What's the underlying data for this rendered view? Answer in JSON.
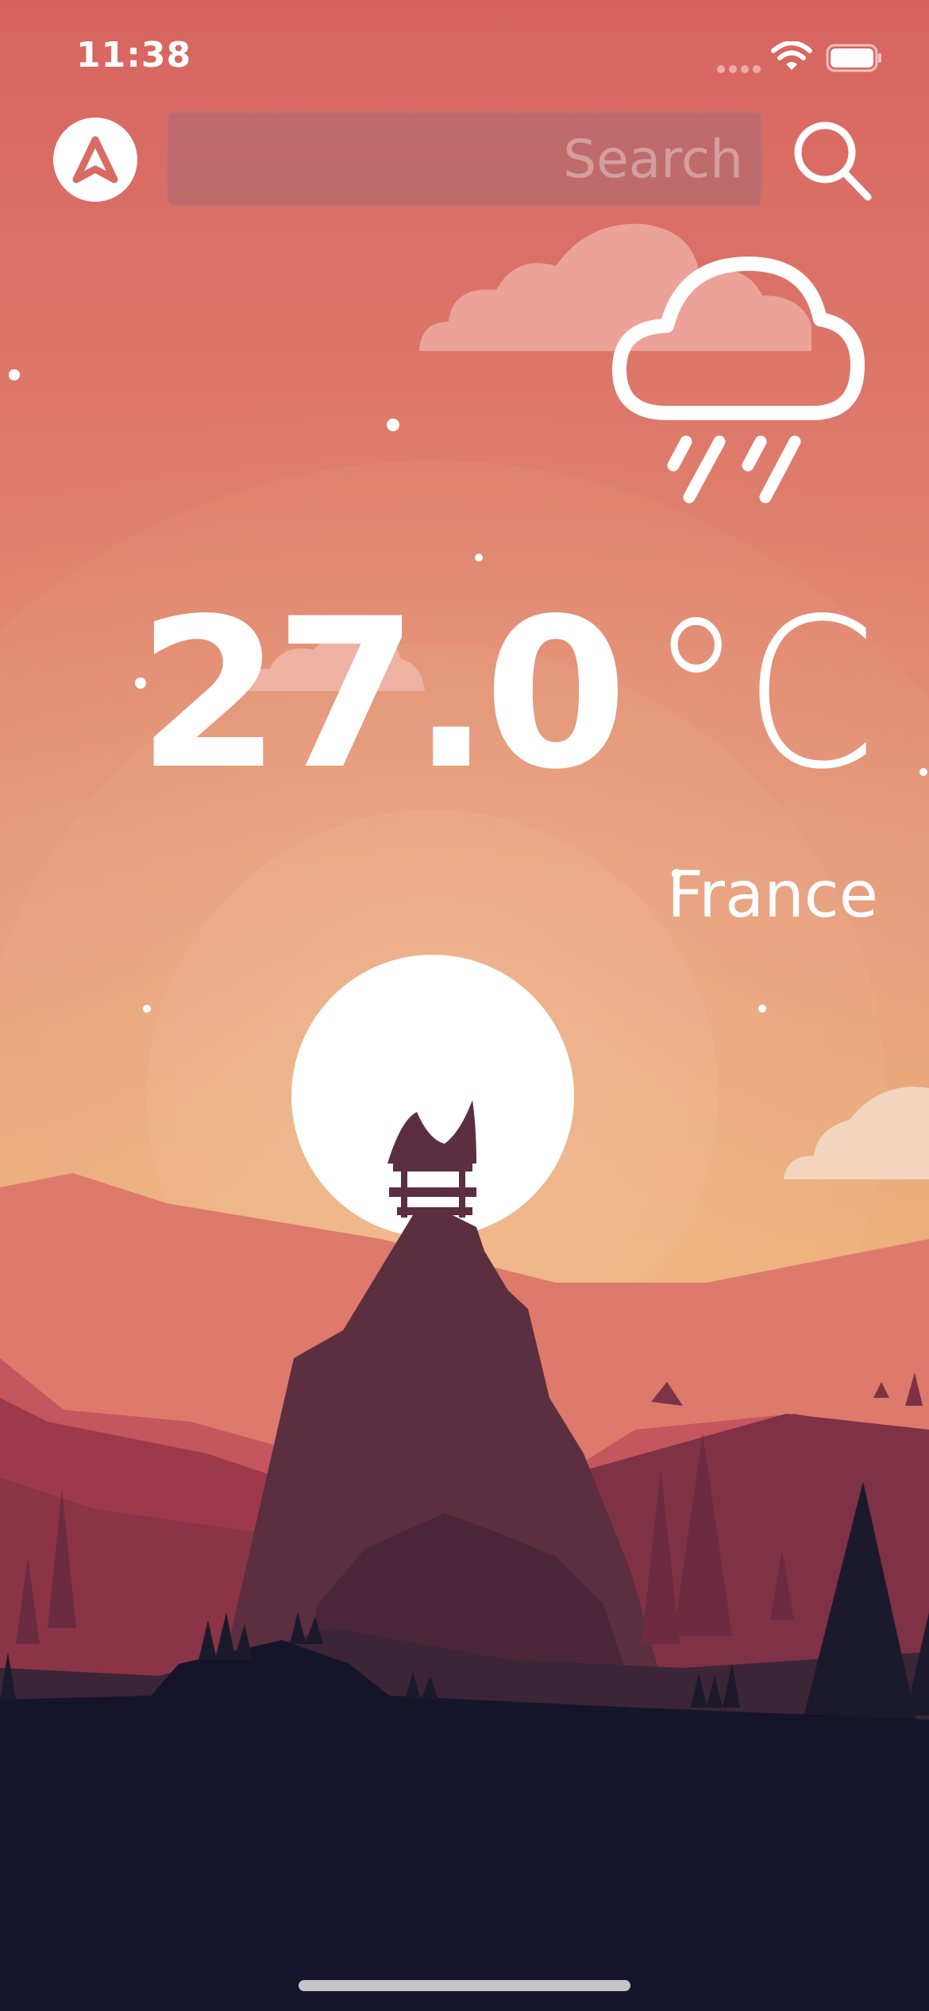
{
  "status_bar": {
    "time": "11:38",
    "wifi_icon": "wifi-icon",
    "battery_icon": "battery-icon"
  },
  "header": {
    "location_button_icon": "navigation-arrow-icon",
    "search": {
      "value": "",
      "placeholder": "Search"
    },
    "search_button_icon": "magnifier-icon"
  },
  "weather": {
    "condition_icon": "cloud-rain-icon",
    "temperature": "27.0",
    "unit": "°C",
    "location": "France"
  },
  "colors": {
    "sky_top": "#d96460",
    "sky_bottom": "#ecb474",
    "sun": "#ffffff",
    "mountain_main": "#5c2f40",
    "ground": "#14142a",
    "text": "#ffffff"
  }
}
